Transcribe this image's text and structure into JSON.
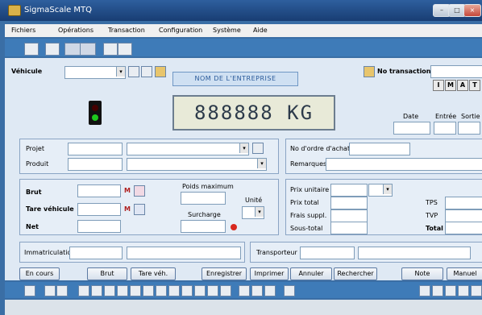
{
  "window": {
    "title": "SigmaScale MTQ"
  },
  "menu": [
    "Fichiers",
    "Opérations",
    "Transaction",
    "Configuration",
    "Système",
    "Aide"
  ],
  "vehicle": {
    "label": "Véhicule"
  },
  "company_name": "NOM DE L'ENTREPRISE",
  "transaction": {
    "label": "No transaction",
    "letters": [
      "I",
      "M",
      "A",
      "T"
    ]
  },
  "display": {
    "weight": "888888",
    "unit": "KG"
  },
  "datetime": {
    "date": "Date",
    "entree": "Entrée",
    "sortie": "Sortie"
  },
  "project_panel": {
    "projet": "Projet",
    "produit": "Produit"
  },
  "order_panel": {
    "no_ordre": "No d'ordre d'achat",
    "remarques": "Remarques"
  },
  "weights": {
    "brut": "Brut",
    "tare": "Tare véhicule",
    "net": "Net",
    "m_label": "M",
    "poids_max": "Poids maximum",
    "surcharge": "Surcharge",
    "unite": "Unité"
  },
  "prices": {
    "prix_unitaire": "Prix unitaire",
    "prix_total": "Prix total",
    "frais": "Frais suppl.",
    "sous_total": "Sous-total",
    "tps": "TPS",
    "tvp": "TVP",
    "total": "Total"
  },
  "immat": {
    "label": "Immatriculation"
  },
  "transporteur": {
    "label": "Transporteur"
  },
  "buttons": [
    "En cours",
    "Brut",
    "Tare véh.",
    "Enregistrer",
    "Imprimer",
    "Annuler",
    "Rechercher",
    "Note",
    "Manuel"
  ],
  "colors": {
    "titlebar": "#183d73",
    "toolbar": "#3e7bb8",
    "client": "#dfe9f4",
    "company_text": "#2a5a9a"
  }
}
